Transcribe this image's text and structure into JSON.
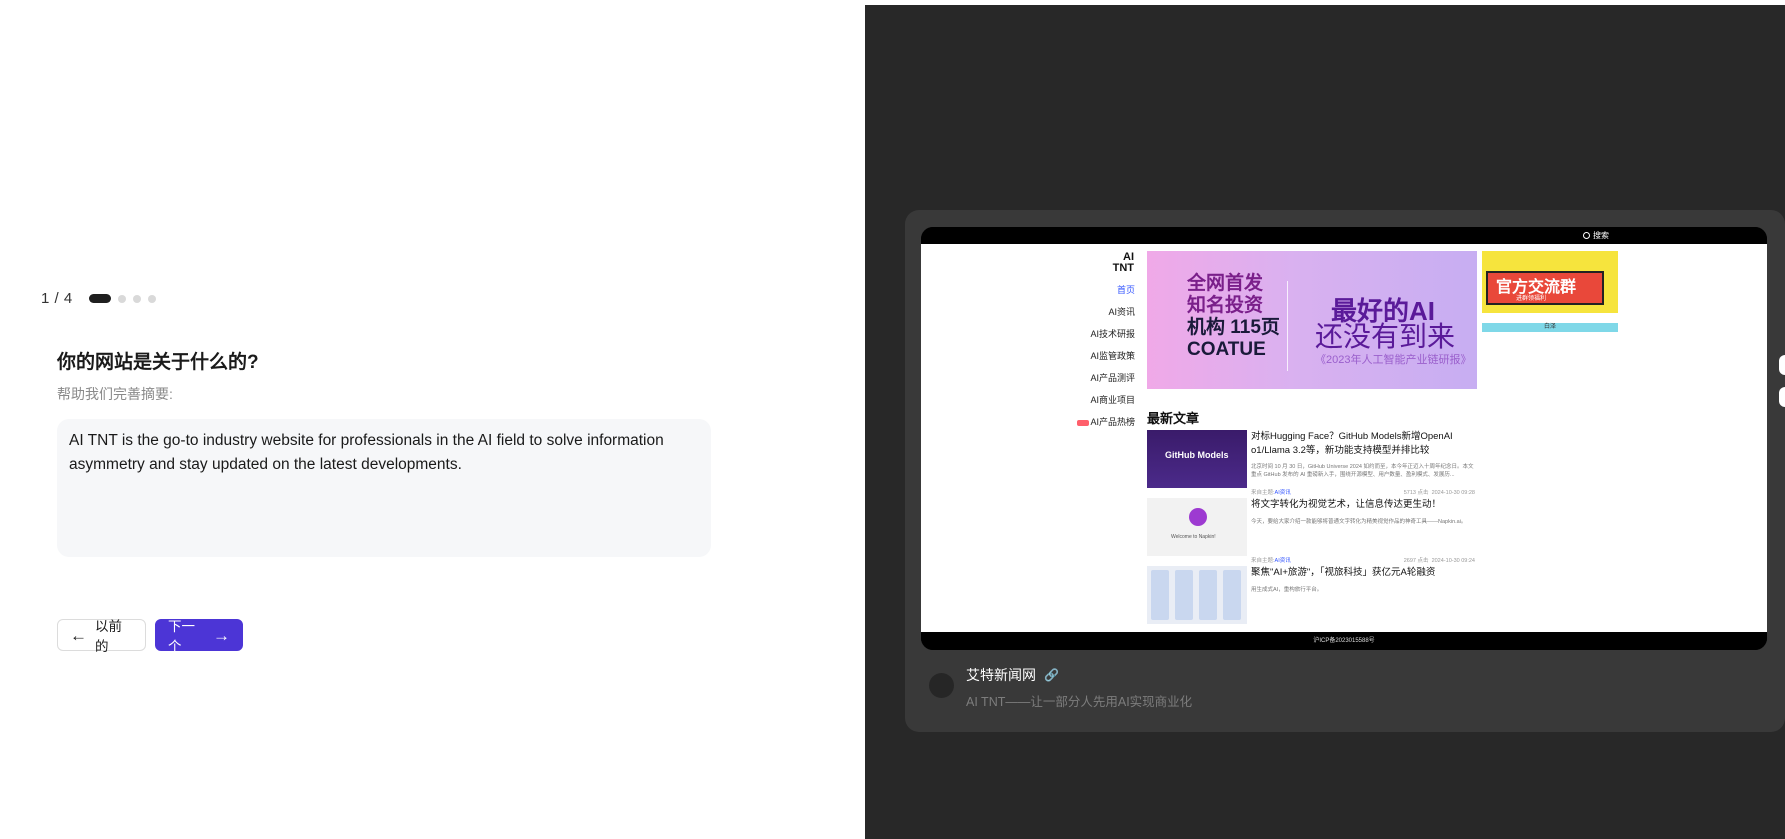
{
  "stepper": {
    "count": "1 / 4",
    "total_steps": 4,
    "current_step": 1
  },
  "question": {
    "title": "你的网站是关于什么的?",
    "subtitle": "帮助我们完善摘要:"
  },
  "answer": {
    "text": "AI TNT is the go-to industry website for professionals in the AI field to solve information asymmetry and stay updated on the latest developments."
  },
  "buttons": {
    "prev_label": "以前的",
    "next_label": "下一个"
  },
  "colors": {
    "accent": "#4c35d6",
    "right_bg": "#282828",
    "card_bg": "#393939"
  },
  "preview": {
    "search_label": "搜索",
    "logo_line1": "AI",
    "logo_line2": "TNT",
    "nav": [
      "首页",
      "AI资讯",
      "AI技术研报",
      "AI监管政策",
      "AI产品测评",
      "AI商业项目",
      "AI产品热榜"
    ],
    "banner": {
      "left_line1": "全网首发",
      "left_line2": "知名投资",
      "left_line3": "机构 115页",
      "left_line4": "COATUE",
      "right_line1": "最好的AI",
      "right_line2": "还没有到来",
      "right_line3": "《2023年人工智能产业链研报》"
    },
    "ad": {
      "title": "官方交流群",
      "subtitle": "进群领福利",
      "strip": "白泽"
    },
    "latest_heading": "最新文章",
    "articles": [
      {
        "title": "对标Hugging Face？GitHub Models新增OpenAI o1/Llama 3.2等，新功能支持模型并排比较",
        "desc": "北京时间 10 月 30 日，GitHub Universe 2024 如约而至，本今年正迈入十周年纪念日。本文重点 GitHub 发布的 AI 重磅新入手，围绕开源模型、用户数量、盈利模式、发展历...",
        "tag": "AI资讯",
        "source": "来自主题:",
        "views": "5713 点击",
        "time": "2024-10-30 09:28",
        "thumb_label": "GitHub Models"
      },
      {
        "title": "将文字转化为视觉艺术，让信息传达更生动！",
        "desc": "今天，要给大家介绍一款能够将普通文字转化为精美视觉作品的神奇工具——Napkin.ai。",
        "tag": "AI资讯",
        "source": "来自主题:",
        "views": "2697 点击",
        "time": "2024-10-30 09:24",
        "thumb_label": "Welcome to Napkin!"
      },
      {
        "title": "聚焦\"AI+旅游\"，「视旅科技」获亿元A轮融资",
        "desc": "用生成式AI，重构旅行平台。",
        "tag": "",
        "source": "",
        "views": "",
        "time": "",
        "thumb_label": ""
      }
    ],
    "footer": "沪ICP备2023015588号"
  },
  "site": {
    "name": "艾特新闻网",
    "description": "AI TNT——让一部分人先用AI实现商业化"
  }
}
